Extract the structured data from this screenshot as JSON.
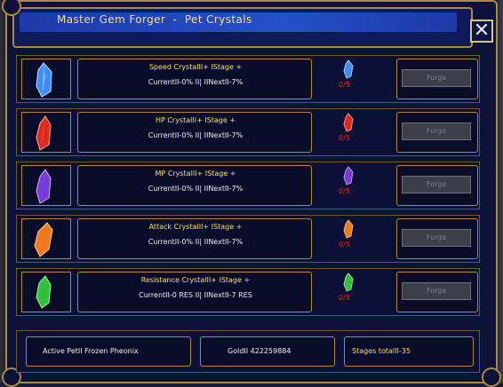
{
  "window": {
    "title": "Master Gem Forger  -  Pet Crystals",
    "close_label": "✕"
  },
  "rows": [
    {
      "name": "Speed CrystalII+ IStage +",
      "stats": "CurrentII-0% II| IINextII-7%",
      "count": "0/5",
      "forge_label": "Forge",
      "gem_color": "#3a8cff",
      "gem_icon": "blue-crystal-icon"
    },
    {
      "name": "HP CrystalII+ IStage +",
      "stats": "CurrentII-0% II| IINextII-7%",
      "count": "0/5",
      "forge_label": "Forge",
      "gem_color": "#e2281c",
      "gem_icon": "red-crystal-icon"
    },
    {
      "name": "MP CrystalII+ IStage +",
      "stats": "CurrentII-0% II| IINextII-7%",
      "count": "0/5",
      "forge_label": "Forge",
      "gem_color": "#7a3ad8",
      "gem_icon": "purple-crystal-icon"
    },
    {
      "name": "Attack CrystalII+ IStage +",
      "stats": "CurrentII-0% II| IINextII-7%",
      "count": "0/5",
      "forge_label": "Forge",
      "gem_color": "#f07a1a",
      "gem_icon": "orange-crystal-icon"
    },
    {
      "name": "Resistance CrystalII+ IStage +",
      "stats": "CurrentII-0 RES II| IINextII-7 RES",
      "count": "0/5",
      "forge_label": "Forge",
      "gem_color": "#2ec23a",
      "gem_icon": "green-crystal-icon"
    }
  ],
  "footer": {
    "active_pet": "Active PetII Frozen Pheonix",
    "gold": "GoldII 422259884",
    "stages_total": "Stages totalII-35"
  },
  "colors": {
    "accent_gold": "#b08a3a",
    "title_yellow": "#f2e27a",
    "count_red": "#e02a1a"
  }
}
